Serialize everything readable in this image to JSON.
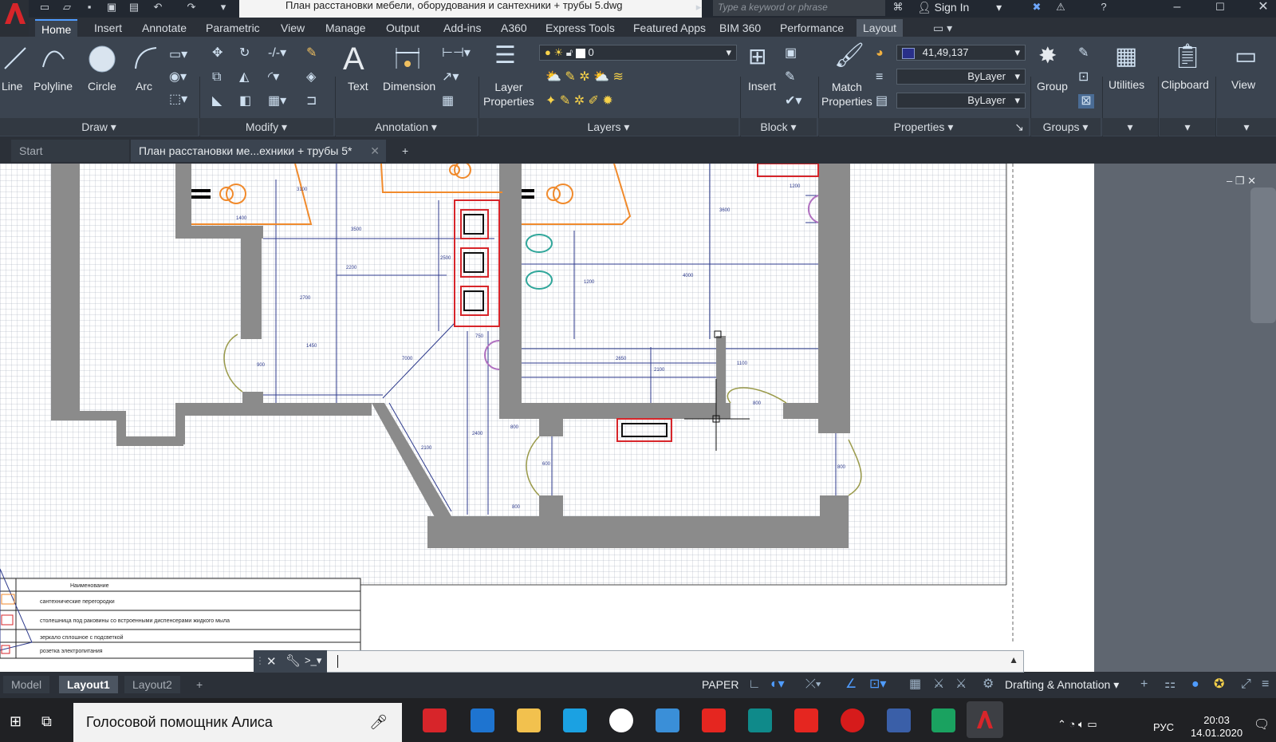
{
  "app": {
    "doc_title": "План расстановки мебели, оборудования и сантехники + трубы 5.dwg",
    "search_placeholder": "Type a keyword or phrase",
    "sign_in": "Sign In"
  },
  "ribbon_tabs": [
    "Home",
    "Insert",
    "Annotate",
    "Parametric",
    "View",
    "Manage",
    "Output",
    "Add-ins",
    "A360",
    "Express Tools",
    "Featured Apps",
    "BIM 360",
    "Performance",
    "Layout"
  ],
  "ribbon": {
    "draw": {
      "line": "Line",
      "polyline": "Polyline",
      "circle": "Circle",
      "arc": "Arc",
      "panel": "Draw"
    },
    "modify_panel": "Modify",
    "annotation": {
      "text": "Text",
      "dimension": "Dimension",
      "panel": "Annotation"
    },
    "layers": {
      "props_line1": "Layer",
      "props_line2": "Properties",
      "panel": "Layers",
      "current": "0"
    },
    "block": {
      "insert": "Insert",
      "panel": "Block"
    },
    "properties": {
      "match_line1": "Match",
      "match_line2": "Properties",
      "color": "41,49,137",
      "linetype": "ByLayer",
      "lineweight": "ByLayer",
      "panel": "Properties"
    },
    "groups": {
      "group": "Group",
      "panel": "Groups"
    },
    "utilities": "Utilities",
    "clipboard": "Clipboard",
    "view": "View"
  },
  "file_tabs": {
    "start": "Start",
    "current": "План расстановки ме...ехники + трубы 5*",
    "add": "+"
  },
  "drawing": {
    "dims": [
      "3100",
      "1400",
      "3500",
      "2200",
      "2700",
      "1450",
      "900",
      "7000",
      "2500",
      "750",
      "3600",
      "1200",
      "4000",
      "2650",
      "2100",
      "1100",
      "800",
      "2400",
      "800",
      "2100",
      "600",
      "800",
      "800",
      "1200"
    ],
    "legend": {
      "header": "Наименование",
      "rows": [
        "сантехнические перегородки",
        "столешница под раковины со встроенными диспенсерами жидкого мыла",
        "зеркало сплошное с подсветкой",
        "розетка электропитания"
      ]
    }
  },
  "layout_tabs": [
    "Model",
    "Layout1",
    "Layout2",
    "+"
  ],
  "status": {
    "paper": "PAPER",
    "workspace": "Drafting & Annotation"
  },
  "taskbar": {
    "assistant": "Голосовой помощник Алиса",
    "lang": "РУС",
    "time": "20:03",
    "date": "14.01.2020"
  },
  "colors": {
    "accent": "#4f9cff",
    "wall": "#8b8b8b",
    "blue_lines": "#2d3a8c",
    "orange": "#f08a2c",
    "red": "#d7252a",
    "teal": "#2fa69a"
  }
}
